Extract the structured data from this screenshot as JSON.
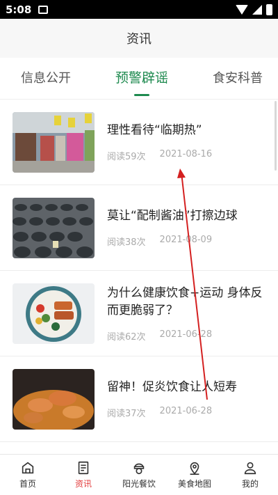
{
  "status_bar": {
    "time": "5:08"
  },
  "header": {
    "title": "资讯"
  },
  "tabs": [
    {
      "label": "信息公开"
    },
    {
      "label": "预警辟谣"
    },
    {
      "label": "食安科普"
    }
  ],
  "articles": [
    {
      "title": "理性看待“临期热”",
      "reads": "阅读59次",
      "date": "2021-08-16"
    },
    {
      "title": "莫让“配制酱油”打擦边球",
      "reads": "阅读38次",
      "date": "2021-08-09"
    },
    {
      "title": "为什么健康饮食+运动 身体反而更脆弱了？",
      "reads": "阅读62次",
      "date": "2021-06-28"
    },
    {
      "title": "留神！促炎饮食让人短寿",
      "reads": "阅读37次",
      "date": "2021-06-28"
    }
  ],
  "bottom_nav": [
    {
      "label": "首页",
      "icon": "home-icon"
    },
    {
      "label": "资讯",
      "icon": "news-icon"
    },
    {
      "label": "阳光餐饮",
      "icon": "chef-icon"
    },
    {
      "label": "美食地图",
      "icon": "map-pin-icon"
    },
    {
      "label": "我的",
      "icon": "user-icon"
    }
  ],
  "colors": {
    "accent_green": "#1e8a4f",
    "active_red": "#e23b3b",
    "annotation_red": "#d42020"
  }
}
